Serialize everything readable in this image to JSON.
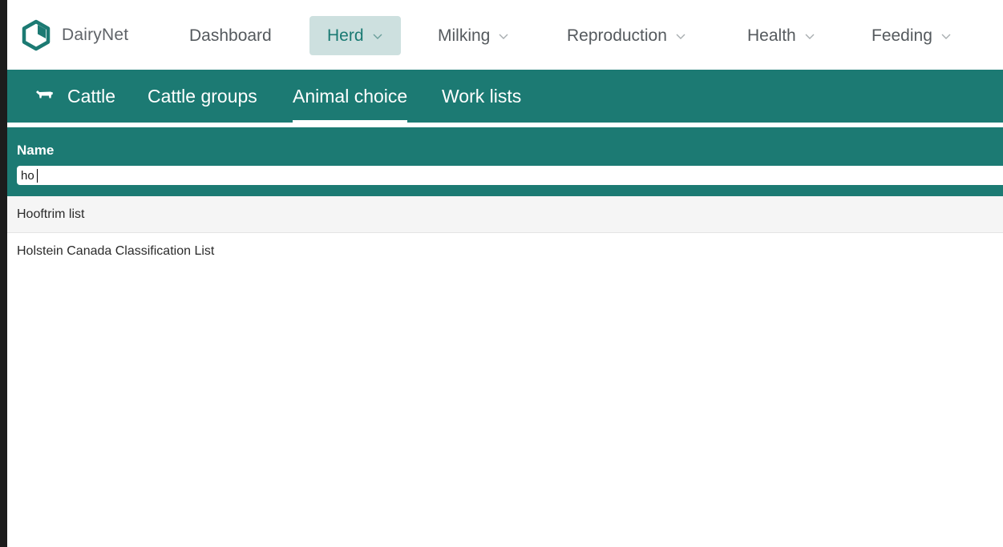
{
  "app": {
    "name": "DairyNet"
  },
  "nav": {
    "items": [
      {
        "label": "Dashboard",
        "has_dropdown": false
      },
      {
        "label": "Herd",
        "has_dropdown": true,
        "active": true
      },
      {
        "label": "Milking",
        "has_dropdown": true
      },
      {
        "label": "Reproduction",
        "has_dropdown": true
      },
      {
        "label": "Health",
        "has_dropdown": true
      },
      {
        "label": "Feeding",
        "has_dropdown": true
      }
    ]
  },
  "subtabs": {
    "items": [
      {
        "label": "Cattle",
        "icon": "cow-icon"
      },
      {
        "label": "Cattle groups"
      },
      {
        "label": "Animal choice",
        "active": true
      },
      {
        "label": "Work lists"
      }
    ]
  },
  "filter": {
    "column_label": "Name",
    "value": "ho"
  },
  "results": [
    {
      "label": "Hooftrim list"
    },
    {
      "label": "Holstein Canada Classification List"
    }
  ],
  "colors": {
    "brand_teal": "#1c7a73",
    "active_nav_bg": "#cde0df"
  }
}
